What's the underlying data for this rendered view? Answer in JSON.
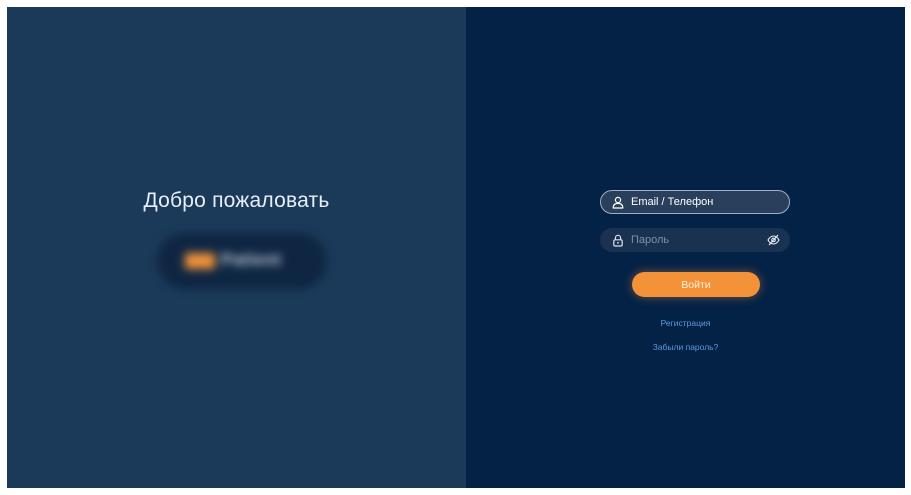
{
  "welcome": {
    "title": "Добро пожаловать",
    "logo_text": "Patient"
  },
  "login_form": {
    "email_placeholder": "Email / Телефон",
    "email_icon": "user-icon",
    "password_placeholder": "Пароль",
    "password_icon": "lock-icon",
    "password_toggle_icon": "eye-off-icon",
    "submit_label": "Войти",
    "register_link": "Регистрация",
    "forgot_link": "Забыли пароль?"
  },
  "colors": {
    "left_background": "#1b3a5a",
    "right_background": "#042146",
    "accent": "#f4923a",
    "link": "#5d9be0"
  }
}
